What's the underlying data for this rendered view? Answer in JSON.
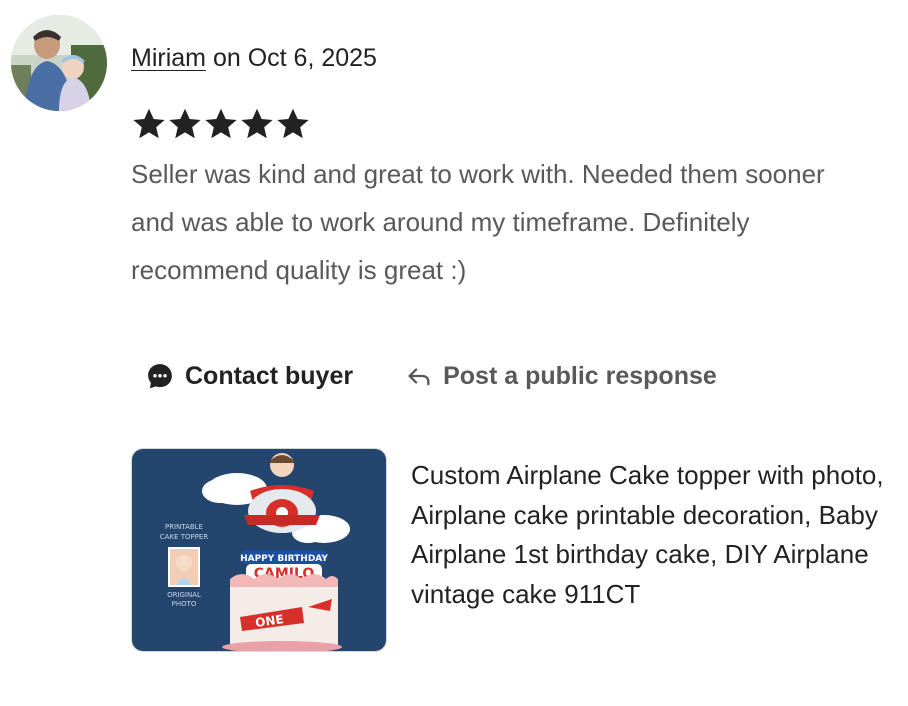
{
  "reviewer": {
    "name": "Miriam",
    "date_text": " on Oct 6, 2025",
    "avatar_icon": "user-photo-avatar"
  },
  "rating": {
    "stars": 5,
    "max": 5,
    "icon": "star-icon",
    "color": "#222222"
  },
  "review": {
    "text": "Seller was kind and great to work with. Needed them sooner and was able to work around my timeframe. Definitely recommend quality is great :)"
  },
  "actions": {
    "contact_label": "Contact buyer",
    "contact_icon": "chat-bubble-icon",
    "respond_label": "Post a public response",
    "respond_icon": "reply-arrow-icon"
  },
  "listing": {
    "title": "Custom Airplane Cake topper with photo, Airplane cake printable decoration, Baby Airplane 1st birthday cake, DIY Airplane vintage cake 911CT",
    "thumbnail": {
      "printable_label_1": "PRINTABLE",
      "printable_label_2": "CAKE TOPPER",
      "original_label_1": "ORIGINAL",
      "original_label_2": "PHOTO",
      "happy_birthday": "HAPPY BIRTHDAY",
      "name": "CAMILO",
      "banner": "ONE",
      "bg_color": "#23456e"
    }
  }
}
